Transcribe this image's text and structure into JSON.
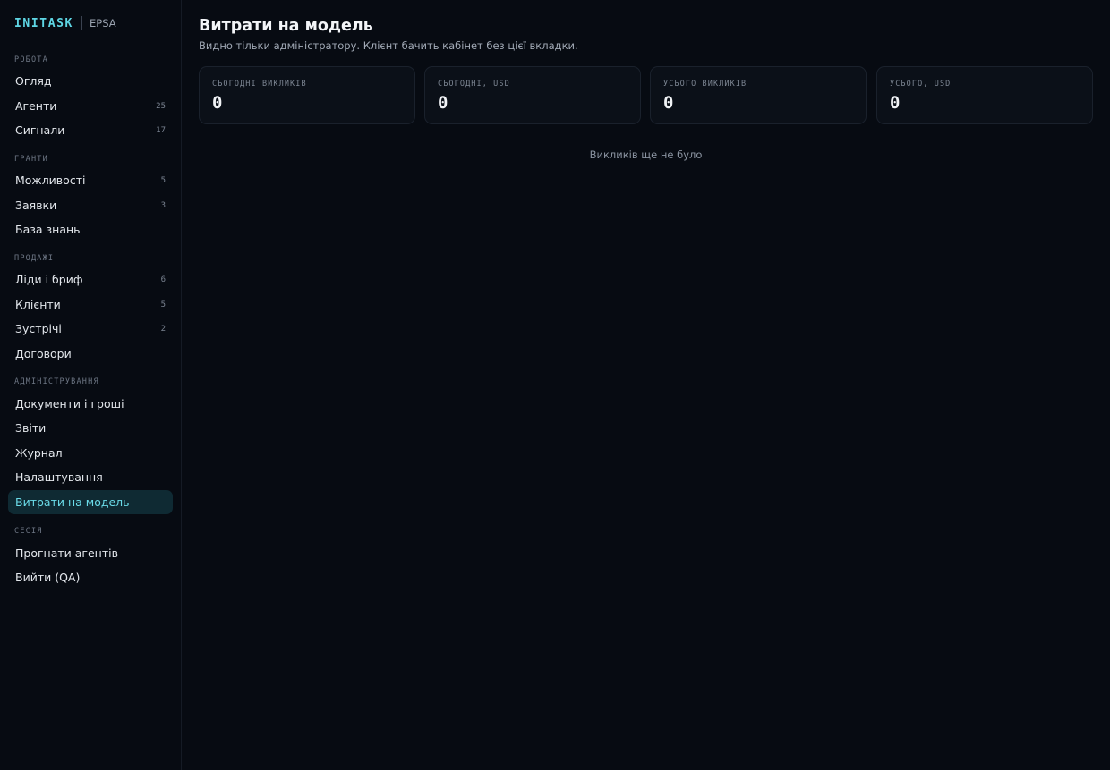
{
  "brand": {
    "logo": "INITASK",
    "org": "EPSA"
  },
  "sidebar": {
    "sections": [
      {
        "title": "РОБОТА",
        "items": [
          {
            "label": "Огляд",
            "count": ""
          },
          {
            "label": "Агенти",
            "count": "25"
          },
          {
            "label": "Сигнали",
            "count": "17"
          }
        ]
      },
      {
        "title": "ГРАНТИ",
        "items": [
          {
            "label": "Можливості",
            "count": "5"
          },
          {
            "label": "Заявки",
            "count": "3"
          },
          {
            "label": "База знань",
            "count": ""
          }
        ]
      },
      {
        "title": "ПРОДАЖІ",
        "items": [
          {
            "label": "Ліди і бриф",
            "count": "6"
          },
          {
            "label": "Клієнти",
            "count": "5"
          },
          {
            "label": "Зустрічі",
            "count": "2"
          },
          {
            "label": "Договори",
            "count": ""
          }
        ]
      },
      {
        "title": "АДМІНІСТРУВАННЯ",
        "items": [
          {
            "label": "Документи і гроші",
            "count": ""
          },
          {
            "label": "Звіти",
            "count": ""
          },
          {
            "label": "Журнал",
            "count": ""
          },
          {
            "label": "Налаштування",
            "count": ""
          },
          {
            "label": "Витрати на модель",
            "count": "",
            "active": true
          }
        ]
      },
      {
        "title": "СЕСІЯ",
        "items": [
          {
            "label": "Прогнати агентів",
            "count": ""
          },
          {
            "label": "Вийти (QA)",
            "count": ""
          }
        ]
      }
    ]
  },
  "page": {
    "title": "Витрати на модель",
    "subtitle": "Видно тільки адміністратору. Клієнт бачить кабінет без цієї вкладки."
  },
  "stats": [
    {
      "label": "СЬОГОДНІ ВИКЛИКІВ",
      "value": "0"
    },
    {
      "label": "СЬОГОДНІ, USD",
      "value": "0"
    },
    {
      "label": "УСЬОГО ВИКЛИКІВ",
      "value": "0"
    },
    {
      "label": "УСЬОГО, USD",
      "value": "0"
    }
  ],
  "empty_state": "Викликів ще не було",
  "colors": {
    "background": "#070b12",
    "accent": "#5ed6e4",
    "active_item_bg": "#0f2a33"
  }
}
